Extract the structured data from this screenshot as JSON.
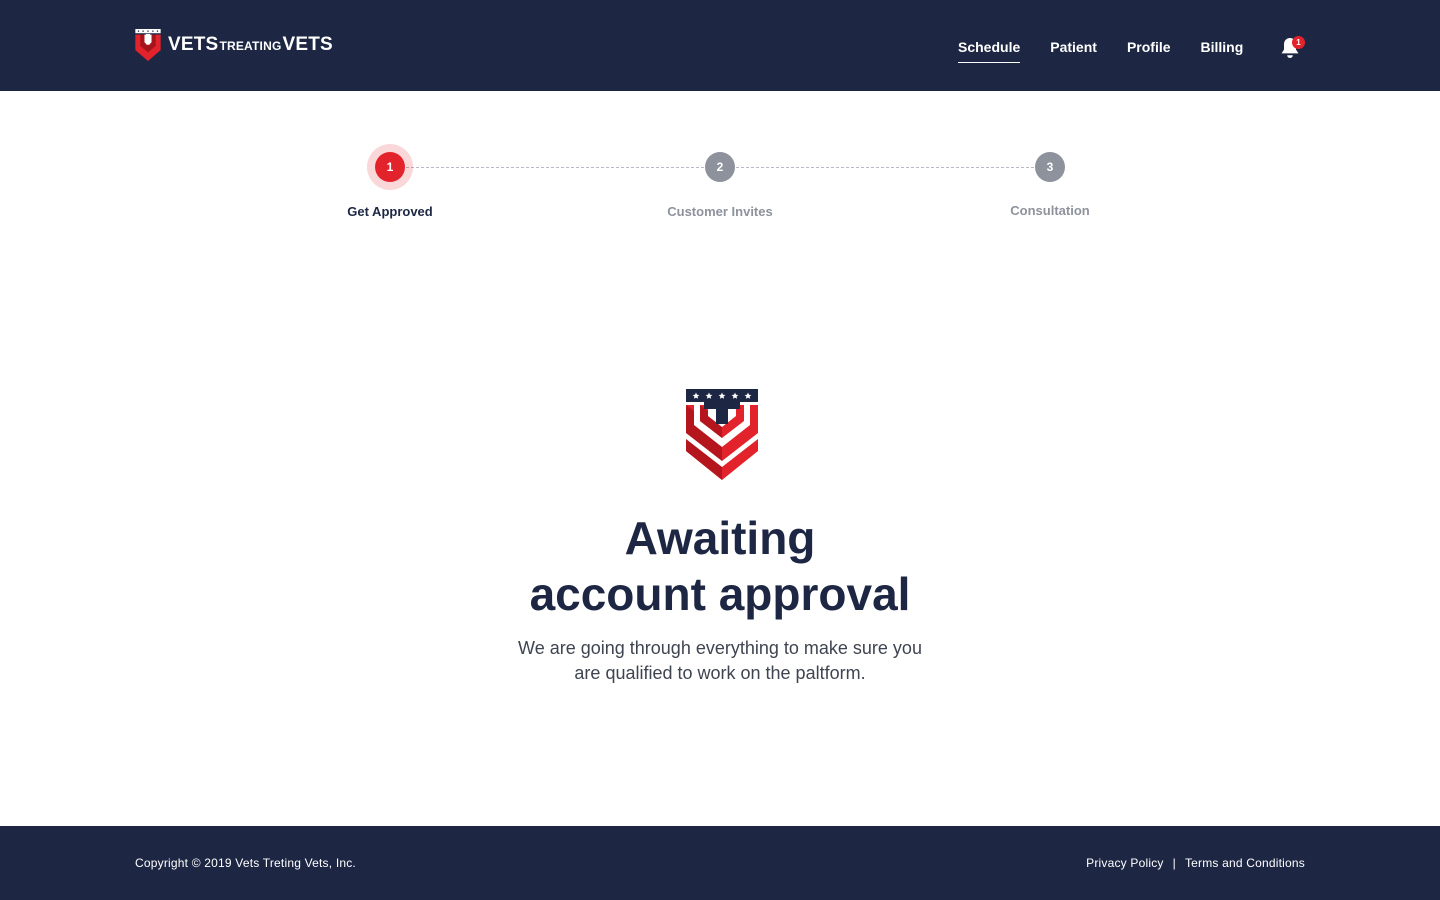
{
  "header": {
    "logo": {
      "part1": "VETS",
      "part2": "TREATING",
      "part3": "VETS"
    },
    "nav": [
      {
        "label": "Schedule",
        "active": true
      },
      {
        "label": "Patient",
        "active": false
      },
      {
        "label": "Profile",
        "active": false
      },
      {
        "label": "Billing",
        "active": false
      }
    ],
    "notifications": {
      "count": "1",
      "icon": "bell-icon"
    }
  },
  "stepper": {
    "steps": [
      {
        "number": "1",
        "label": "Get Approved",
        "state": "active"
      },
      {
        "number": "2",
        "label": "Customer Invites",
        "state": "inactive"
      },
      {
        "number": "3",
        "label": "Consultation",
        "state": "inactive"
      }
    ]
  },
  "main": {
    "title_line1": "Awaiting",
    "title_line2": "account approval",
    "subtitle_line1": "We are going through everything to make sure you",
    "subtitle_line2": "are qualified to work on the paltform."
  },
  "footer": {
    "copyright": "Copyright © 2019 Vets Treting Vets, Inc.",
    "privacy": "Privacy Policy",
    "separator": "|",
    "terms": "Terms and Conditions"
  },
  "colors": {
    "navy": "#1d2744",
    "red": "#e3232b",
    "gray": "#8d929c"
  }
}
